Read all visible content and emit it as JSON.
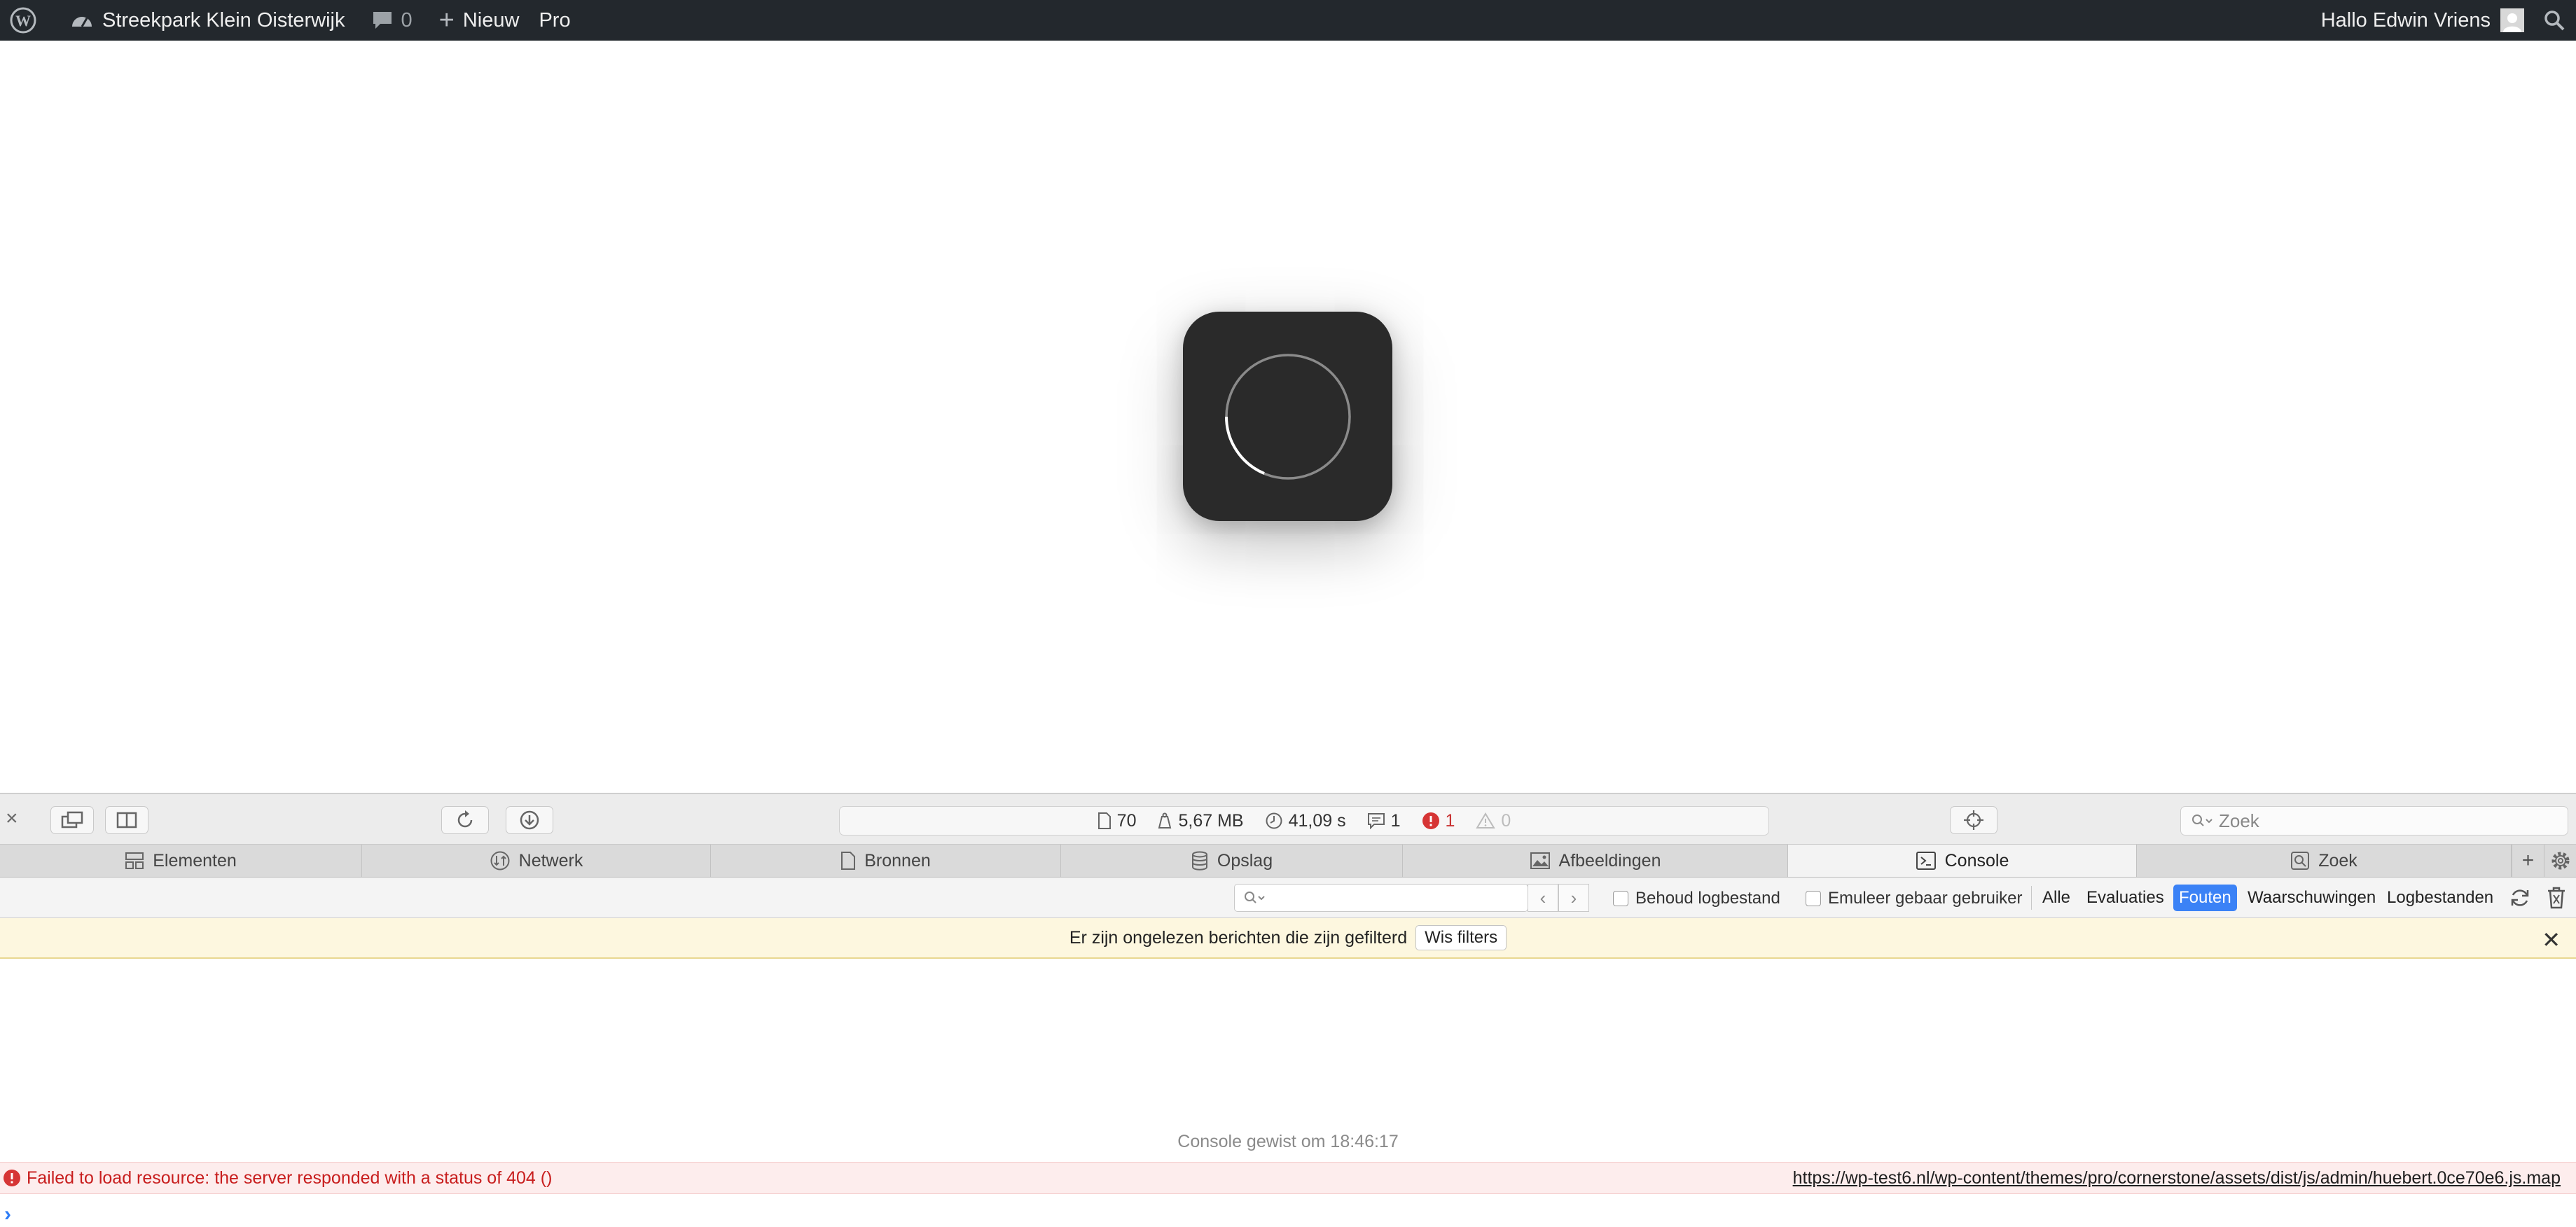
{
  "adminbar": {
    "site_name": "Streekpark Klein Oisterwijk",
    "comments_count": "0",
    "new_label": "Nieuw",
    "pro_label": "Pro",
    "greeting": "Hallo Edwin Vriens"
  },
  "devtools": {
    "status": {
      "resources": "70",
      "size": "5,67 MB",
      "time": "41,09 s",
      "logs": "1",
      "errors": "1",
      "warnings": "0"
    },
    "search_placeholder": "Zoek",
    "tabs": [
      {
        "label": "Elementen"
      },
      {
        "label": "Netwerk"
      },
      {
        "label": "Bronnen"
      },
      {
        "label": "Opslag"
      },
      {
        "label": "Afbeeldingen"
      },
      {
        "label": "Console",
        "active": true
      },
      {
        "label": "Zoek"
      }
    ],
    "filter": {
      "preserve_log": "Behoud logbestand",
      "emulate_user": "Emuleer gebaar gebruiker",
      "levels": [
        "Alle",
        "Evaluaties",
        "Fouten",
        "Waarschuwingen",
        "Logbestanden"
      ],
      "active_level": "Fouten"
    },
    "notice": {
      "text": "Er zijn ongelezen berichten die zijn gefilterd",
      "button": "Wis filters"
    },
    "console": {
      "cleared": "Console gewist om 18:46:17",
      "error_message": "Failed to load resource: the server responded with a status of 404 ()",
      "error_source": "https://wp-test6.nl/wp-content/themes/pro/cornerstone/assets/dist/js/admin/huebert.0ce70e6.js.map"
    }
  }
}
